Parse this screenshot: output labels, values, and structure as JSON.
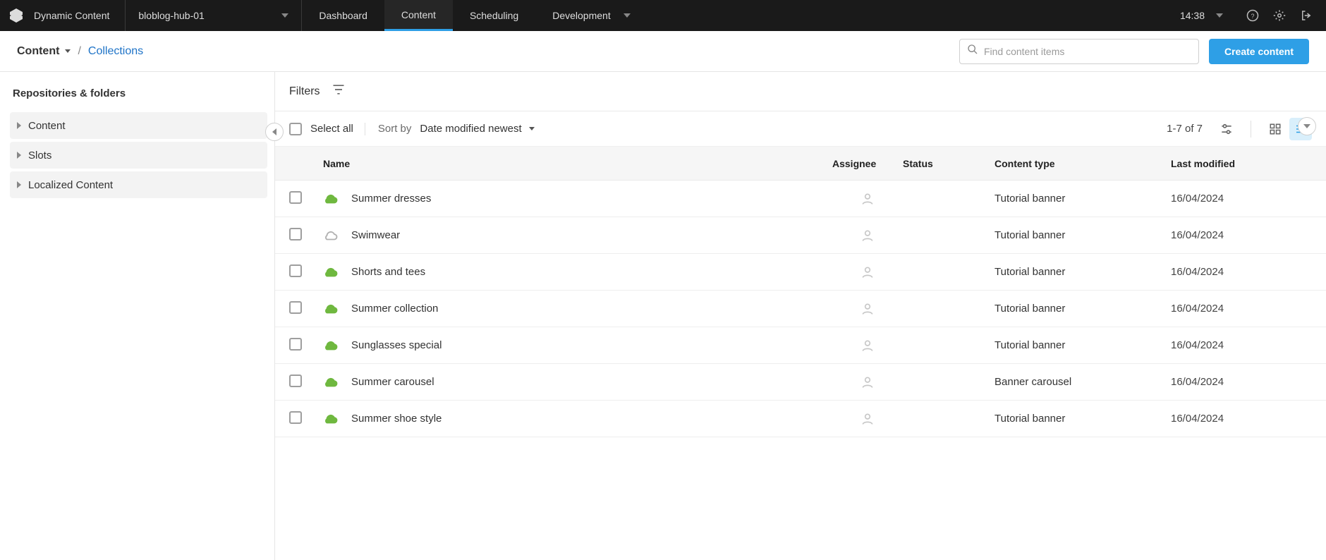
{
  "topbar": {
    "brand": "Dynamic Content",
    "hub": "bloblog-hub-01",
    "tabs": {
      "dashboard": "Dashboard",
      "content": "Content",
      "scheduling": "Scheduling",
      "development": "Development"
    },
    "time": "14:38"
  },
  "subbar": {
    "content_label": "Content",
    "separator": "/",
    "collections_label": "Collections",
    "search_placeholder": "Find content items",
    "create_button": "Create content"
  },
  "sidebar": {
    "title": "Repositories & folders",
    "items": [
      {
        "label": "Content"
      },
      {
        "label": "Slots"
      },
      {
        "label": "Localized Content"
      }
    ]
  },
  "filters": {
    "label": "Filters"
  },
  "toolbar": {
    "select_all": "Select all",
    "sort_by_label": "Sort by",
    "sort_value": "Date modified newest",
    "count": "1-7 of 7"
  },
  "columns": {
    "name": "Name",
    "assignee": "Assignee",
    "status": "Status",
    "content_type": "Content type",
    "last_modified": "Last modified"
  },
  "rows": [
    {
      "name": "Summer dresses",
      "content_type": "Tutorial banner",
      "last_modified": "16/04/2024",
      "published": true
    },
    {
      "name": "Swimwear",
      "content_type": "Tutorial banner",
      "last_modified": "16/04/2024",
      "published": false
    },
    {
      "name": "Shorts and tees",
      "content_type": "Tutorial banner",
      "last_modified": "16/04/2024",
      "published": true
    },
    {
      "name": "Summer collection",
      "content_type": "Tutorial banner",
      "last_modified": "16/04/2024",
      "published": true
    },
    {
      "name": "Sunglasses special",
      "content_type": "Tutorial banner",
      "last_modified": "16/04/2024",
      "published": true
    },
    {
      "name": "Summer carousel",
      "content_type": "Banner carousel",
      "last_modified": "16/04/2024",
      "published": true
    },
    {
      "name": "Summer shoe style",
      "content_type": "Tutorial banner",
      "last_modified": "16/04/2024",
      "published": true
    }
  ],
  "colors": {
    "accent": "#2e9fe6",
    "published": "#6fb83f",
    "unpublished": "#b0b0b0"
  }
}
